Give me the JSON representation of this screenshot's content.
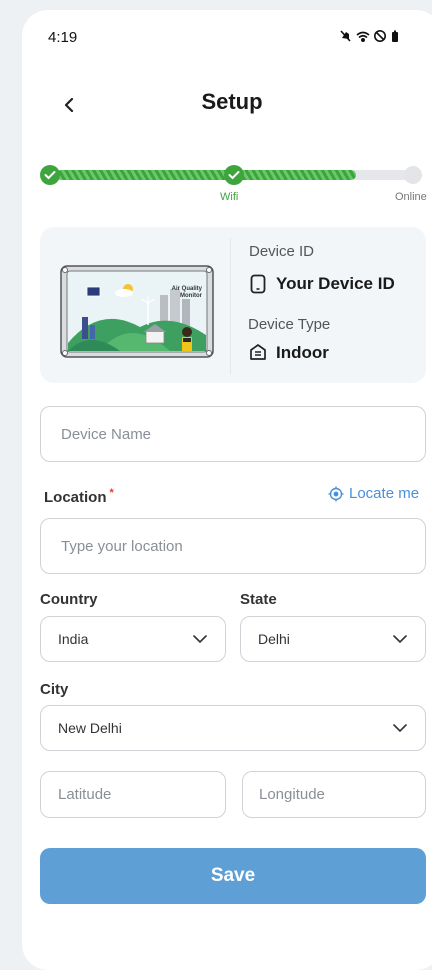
{
  "status_bar": {
    "time": "4:19",
    "icons": [
      "mute-icon",
      "wifi-icon",
      "dnd-icon",
      "battery-icon"
    ]
  },
  "header": {
    "title": "Setup"
  },
  "progress": {
    "steps": [
      {
        "label": ""
      },
      {
        "label": "Wifi"
      },
      {
        "label": "Online"
      }
    ],
    "completed_steps": 2,
    "accent": "#3ea53e"
  },
  "device_card": {
    "image_label": "Air Quality Monitor",
    "device_id_label": "Device ID",
    "device_id_value": "Your Device ID",
    "device_type_label": "Device Type",
    "device_type_value": "Indoor"
  },
  "form": {
    "device_name_placeholder": "Device Name",
    "location_label": "Location",
    "required_mark": "*",
    "locate_me": "Locate me",
    "location_placeholder": "Type your location",
    "country_label": "Country",
    "country_value": "India",
    "state_label": "State",
    "state_value": "Delhi",
    "city_label": "City",
    "city_value": "New Delhi",
    "latitude_placeholder": "Latitude",
    "longitude_placeholder": "Longitude"
  },
  "actions": {
    "save_label": "Save"
  },
  "colors": {
    "accent_green": "#3ea53e",
    "primary_blue": "#5e9fd6",
    "link_blue": "#4a90d9",
    "required_red": "#e53935"
  }
}
